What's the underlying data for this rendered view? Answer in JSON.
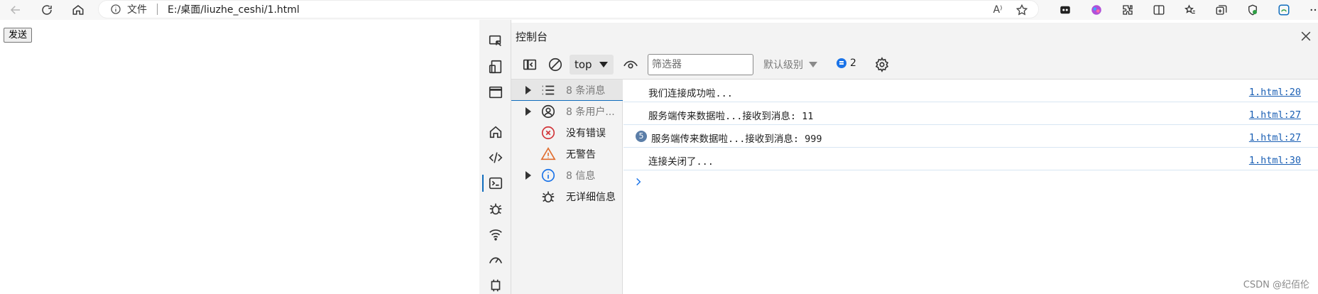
{
  "browser": {
    "file_label": "文件",
    "url": "E:/桌面/liuzhe_ceshi/1.html",
    "read_aloud_label": "A⁾"
  },
  "page": {
    "send_button_label": "发送"
  },
  "devtools": {
    "title": "控制台",
    "context_select": "top",
    "filter_placeholder": "筛选器",
    "filter_value": "",
    "log_level": "默认级别",
    "issues_count": "2",
    "sidebar": [
      {
        "label": "8 条消息",
        "icon": "list-icon",
        "expandable": true,
        "selected": true,
        "muted": true
      },
      {
        "label": "8 条用户...",
        "icon": "user-icon",
        "expandable": true,
        "selected": false,
        "muted": true
      },
      {
        "label": "没有错误",
        "icon": "error-icon",
        "expandable": false,
        "selected": false,
        "muted": false
      },
      {
        "label": "无警告",
        "icon": "warning-icon",
        "expandable": false,
        "selected": false,
        "muted": false
      },
      {
        "label": "8 信息",
        "icon": "info-icon",
        "expandable": true,
        "selected": false,
        "muted": true
      },
      {
        "label": "无详细信息",
        "icon": "bug-icon",
        "expandable": false,
        "selected": false,
        "muted": false
      }
    ],
    "logs": [
      {
        "message": "我们连接成功啦...",
        "source": "1.html:20",
        "count": ""
      },
      {
        "message": "服务端传来数据啦...接收到消息: 11",
        "source": "1.html:27",
        "count": ""
      },
      {
        "message": "服务端传来数据啦...接收到消息: 999",
        "source": "1.html:27",
        "count": "5"
      },
      {
        "message": "连接关闭了...",
        "source": "1.html:30",
        "count": ""
      }
    ]
  },
  "watermark": "CSDN @纪佰伦",
  "colors": {
    "accent": "#0f6cbd",
    "link": "#1a5fb4",
    "devtools_bg": "#f3f3f3",
    "error": "#d13438",
    "warning": "#e06c2d",
    "info": "#1a73e8"
  }
}
